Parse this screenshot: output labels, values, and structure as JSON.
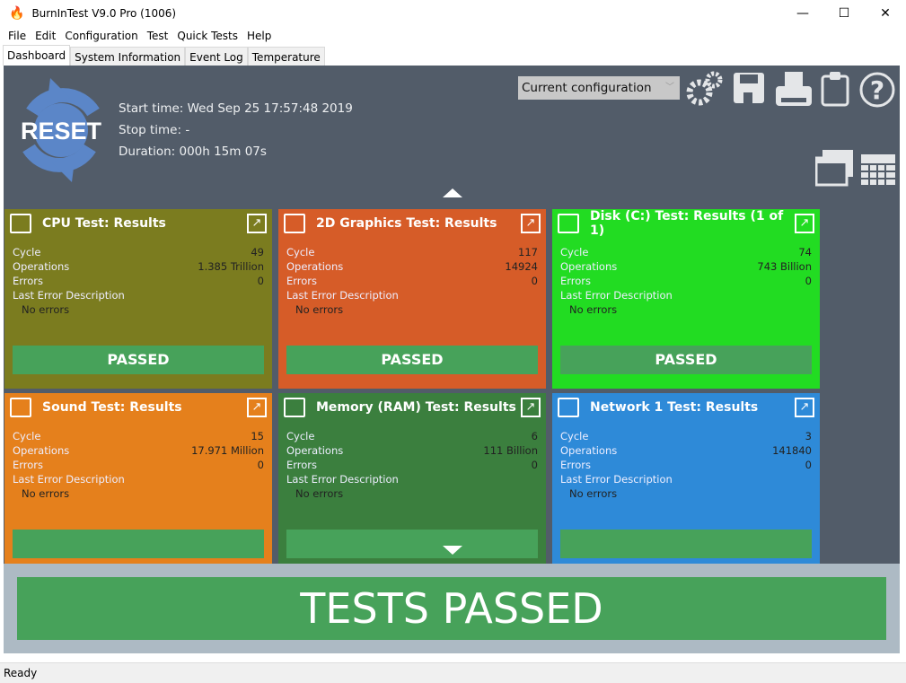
{
  "window": {
    "title": "BurnInTest V9.0 Pro (1006)",
    "minimize": "—",
    "maximize": "☐",
    "close": "✕"
  },
  "menu": [
    "File",
    "Edit",
    "Configuration",
    "Test",
    "Quick Tests",
    "Help"
  ],
  "tabs": [
    "Dashboard",
    "System Information",
    "Event Log",
    "Temperature"
  ],
  "dashboard": {
    "reset_label": "RESET",
    "start_time": "Start time: Wed Sep 25 17:57:48 2019",
    "stop_time": "Stop time: -",
    "duration": "Duration: 000h 15m 07s",
    "config_select": "Current configuration"
  },
  "row_labels": {
    "cycle": "Cycle",
    "operations": "Operations",
    "errors": "Errors",
    "last_error": "Last Error Description"
  },
  "cards": [
    {
      "title": "CPU Test: Results",
      "color": "#7b7c1f",
      "cycle": "49",
      "operations": "1.385 Trillion",
      "errors": "0",
      "last_error": "No errors",
      "status": "PASSED"
    },
    {
      "title": "2D Graphics Test: Results",
      "color": "#d65c28",
      "cycle": "117",
      "operations": "14924",
      "errors": "0",
      "last_error": "No errors",
      "status": "PASSED"
    },
    {
      "title": "Disk (C:) Test: Results (1 of 1)",
      "color": "#22dc22",
      "cycle": "74",
      "operations": "743 Billion",
      "errors": "0",
      "last_error": "No errors",
      "status": "PASSED"
    },
    {
      "title": "Sound Test: Results",
      "color": "#e5801c",
      "cycle": "15",
      "operations": "17.971 Million",
      "errors": "0",
      "last_error": "No errors",
      "status": ""
    },
    {
      "title": "Memory (RAM) Test: Results",
      "color": "#3b7f3e",
      "cycle": "6",
      "operations": "111 Billion",
      "errors": "0",
      "last_error": "No errors",
      "status": ""
    },
    {
      "title": "Network 1 Test: Results",
      "color": "#2e8ad8",
      "cycle": "3",
      "operations": "141840",
      "errors": "0",
      "last_error": "No errors",
      "status": ""
    }
  ],
  "result_banner": "TESTS PASSED",
  "status_bar": "Ready"
}
